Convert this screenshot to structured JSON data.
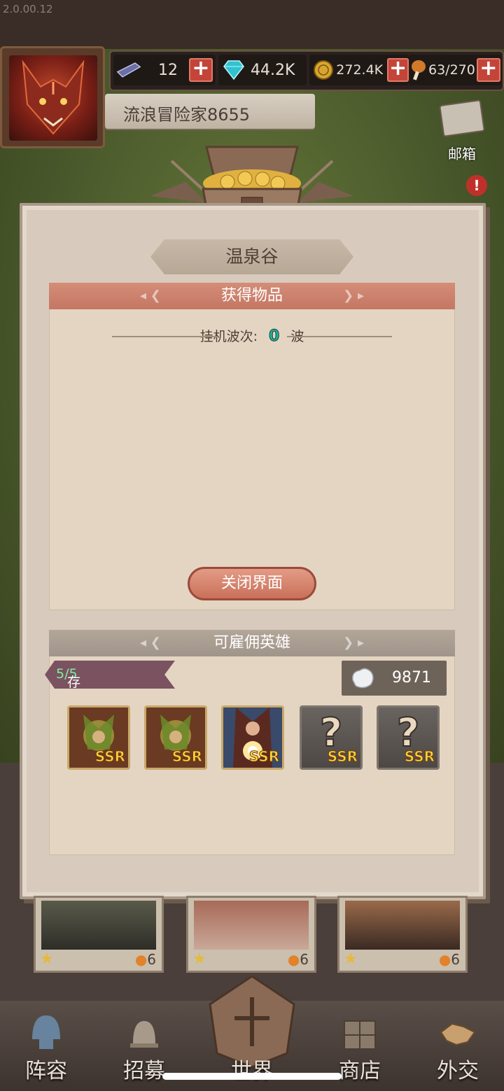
{
  "version": "2.0.00.12",
  "header": {
    "resources": [
      {
        "icon": "stamina-bar-icon",
        "value": "12",
        "has_plus": true
      },
      {
        "icon": "diamond-icon",
        "value": "44.2K",
        "has_plus": false
      },
      {
        "icon": "gold-coin-icon",
        "value": "272.4K",
        "has_plus": true
      },
      {
        "icon": "drumstick-icon",
        "value": "63/270",
        "has_plus": true
      }
    ],
    "player_name": "流浪冒险家8655",
    "mail_label": "邮箱",
    "alert": "!"
  },
  "panel": {
    "title": "温泉谷",
    "items_header": "获得物品",
    "wave_label": "挂机波次:",
    "wave_count": "0",
    "wave_unit": "波",
    "close_button": "关闭界面",
    "heroes_header": "可雇佣英雄",
    "storage_label": "存储数量:",
    "storage_value": "5/5",
    "silver_value": "9871",
    "heroes": [
      {
        "rarity": "SSR",
        "portrait": "forest-dryad",
        "known": true
      },
      {
        "rarity": "SSR",
        "portrait": "forest-dryad",
        "known": true
      },
      {
        "rarity": "SSR",
        "portrait": "fire-mage",
        "known": true
      },
      {
        "rarity": "SSR",
        "portrait": "unknown",
        "known": false,
        "symbol": "?"
      },
      {
        "rarity": "SSR",
        "portrait": "unknown",
        "known": false,
        "symbol": "?"
      }
    ]
  },
  "cards": [
    {
      "cost": "6"
    },
    {
      "cost": "6"
    },
    {
      "cost": "6"
    }
  ],
  "nav": {
    "lineup": "阵容",
    "recruit": "招募",
    "world": "世界",
    "shop": "商店",
    "diplomacy": "外交"
  },
  "colors": {
    "accent_red": "#c47763",
    "wave_teal": "#27b09a",
    "ssr_gold": "#ffd23a",
    "storage_green": "#7cf0a0"
  }
}
